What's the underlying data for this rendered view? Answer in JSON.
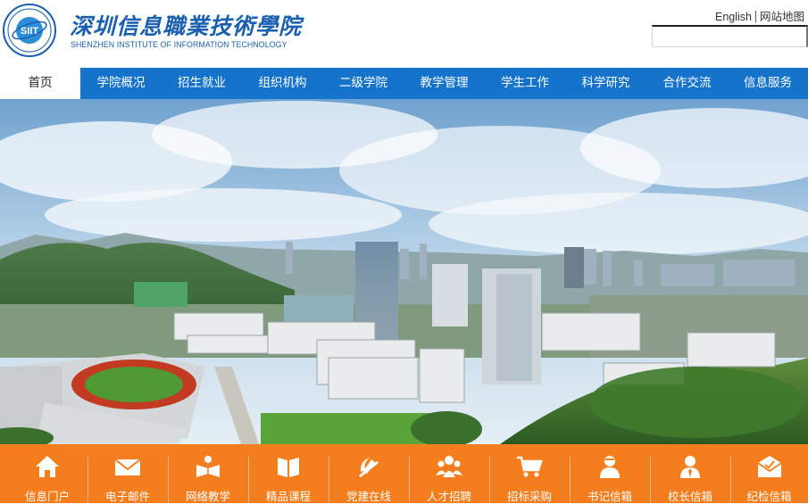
{
  "header": {
    "logo_cn": "深圳信息職業技術學院",
    "logo_en": "SHENZHEN INSTITUTE OF INFORMATION TECHNOLOGY",
    "emblem_text": "SIIT",
    "links": {
      "english": "English",
      "sitemap": "网站地图"
    },
    "search": {
      "value": "",
      "placeholder": ""
    }
  },
  "nav": {
    "items": [
      {
        "label": "首页",
        "active": true
      },
      {
        "label": "学院概况"
      },
      {
        "label": "招生就业"
      },
      {
        "label": "组织机构"
      },
      {
        "label": "二级学院"
      },
      {
        "label": "教学管理"
      },
      {
        "label": "学生工作"
      },
      {
        "label": "科学研究"
      },
      {
        "label": "合作交流"
      },
      {
        "label": "信息服务"
      }
    ]
  },
  "quicklinks": [
    {
      "label": "信息门户",
      "icon": "home-icon"
    },
    {
      "label": "电子邮件",
      "icon": "envelope-icon"
    },
    {
      "label": "网络教学",
      "icon": "book-icon"
    },
    {
      "label": "精品课程",
      "icon": "open-book-icon"
    },
    {
      "label": "党建在线",
      "icon": "party-emblem-icon"
    },
    {
      "label": "人才招聘",
      "icon": "people-icon"
    },
    {
      "label": "招标采购",
      "icon": "cart-icon"
    },
    {
      "label": "书记信箱",
      "icon": "person-icon"
    },
    {
      "label": "校长信箱",
      "icon": "person-tie-icon"
    },
    {
      "label": "纪检信箱",
      "icon": "mail-check-icon"
    }
  ],
  "colors": {
    "brand_blue": "#1673cc",
    "logo_blue": "#1a5fb0",
    "quickbar_orange": "#f47e1d"
  }
}
